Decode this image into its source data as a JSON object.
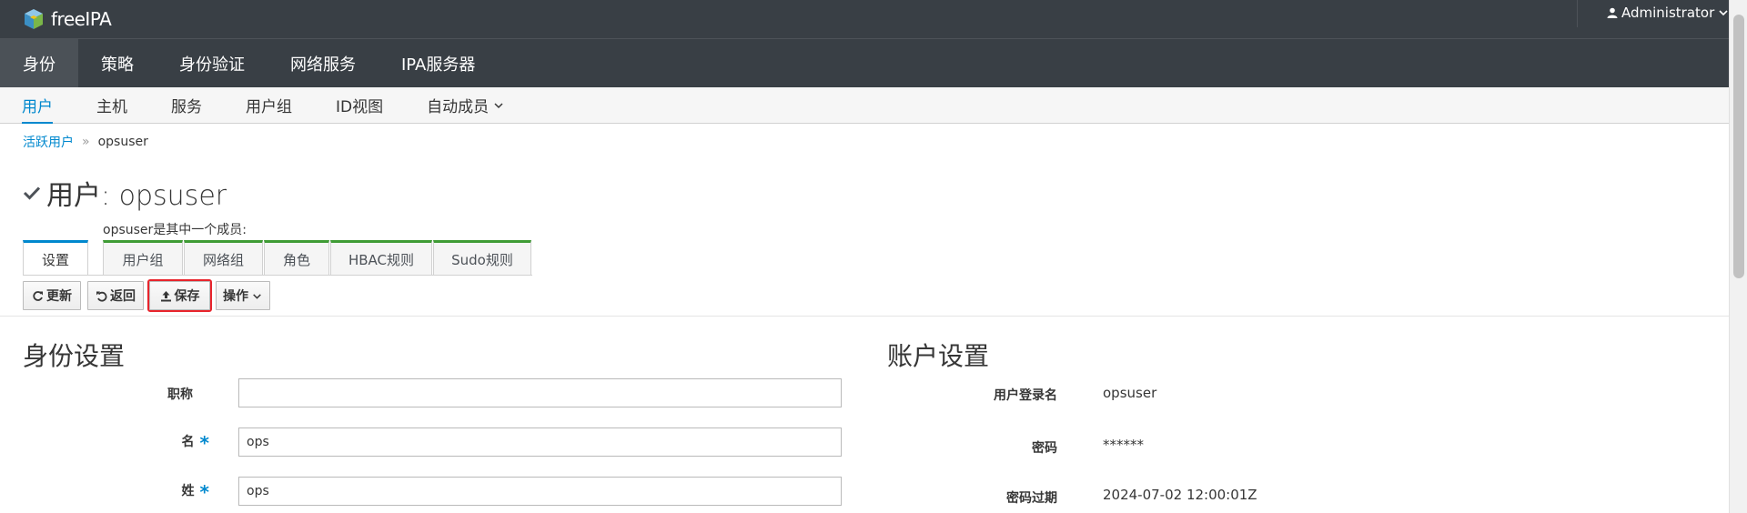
{
  "brand": {
    "name": "freeIPA"
  },
  "user_menu": {
    "label": "Administrator"
  },
  "primary_nav": [
    {
      "label": "身份",
      "active": true
    },
    {
      "label": "策略"
    },
    {
      "label": "身份验证"
    },
    {
      "label": "网络服务"
    },
    {
      "label": "IPA服务器"
    }
  ],
  "secondary_nav": [
    {
      "label": "用户",
      "active": true
    },
    {
      "label": "主机"
    },
    {
      "label": "服务"
    },
    {
      "label": "用户组"
    },
    {
      "label": "ID视图"
    },
    {
      "label": "自动成员"
    }
  ],
  "breadcrumb": {
    "parent": "活跃用户",
    "separator": "»",
    "current": "opsuser"
  },
  "page": {
    "title": "用户: opsuser",
    "member_of_label": "opsuser是其中一个成员:"
  },
  "facet_tabs": {
    "settings": "设置",
    "groups": [
      "用户组",
      "网络组",
      "角色",
      "HBAC规则",
      "Sudo规则"
    ]
  },
  "toolbar": {
    "refresh": "更新",
    "revert": "返回",
    "save": "保存",
    "actions": "操作"
  },
  "identity_section": {
    "title": "身份设置",
    "fields": [
      {
        "label": "职称",
        "value": "",
        "required": false
      },
      {
        "label": "名",
        "value": "ops",
        "required": true
      },
      {
        "label": "姓",
        "value": "ops",
        "required": true
      }
    ],
    "required_mark": "*"
  },
  "account_section": {
    "title": "账户设置",
    "fields": [
      {
        "label": "用户登录名",
        "value": "opsuser"
      },
      {
        "label": "密码",
        "value": "******"
      },
      {
        "label": "密码过期",
        "value": "2024-07-02 12:00:01Z"
      }
    ]
  },
  "colors": {
    "topbar": "#393f45",
    "accent": "#0088ce",
    "tab_green": "#3f9c35",
    "highlight": "#e8242c"
  }
}
